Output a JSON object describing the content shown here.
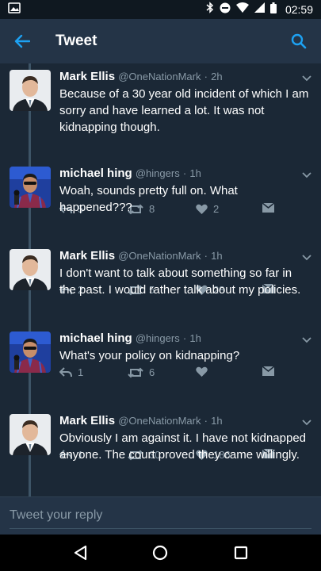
{
  "status_bar": {
    "time": "02:59"
  },
  "app_bar": {
    "title": "Tweet"
  },
  "tweets": [
    {
      "name": "Mark Ellis",
      "handle": "@OneNationMark",
      "time": "2h",
      "text": "Because of a 30 year old incident of which I am sorry and have learned a lot. It was not kidnapping though.",
      "replies": "5",
      "retweets": "8",
      "likes": "2",
      "avatar": "mark-ellis"
    },
    {
      "name": "michael hing",
      "handle": "@hingers",
      "time": "1h",
      "text": "Woah, sounds pretty full on. What happened???",
      "replies": "2",
      "retweets": "5",
      "likes": "28",
      "avatar": "michael-hing"
    },
    {
      "name": "Mark Ellis",
      "handle": "@OneNationMark",
      "time": "1h",
      "text": "I don't want to talk about something so far in the past. I would rather talk about my policies.",
      "replies": "1",
      "retweets": "6",
      "likes": "",
      "avatar": "mark-ellis"
    },
    {
      "name": "michael hing",
      "handle": "@hingers",
      "time": "1h",
      "text": "What's your policy on kidnapping?",
      "replies": "1",
      "retweets": "30",
      "likes": "186",
      "avatar": "michael-hing"
    },
    {
      "name": "Mark Ellis",
      "handle": "@OneNationMark",
      "time": "1h",
      "text": "Obviously I am against it. I have not kidnapped anyone. The court proved they came willingly.",
      "replies": "12",
      "retweets": "14",
      "likes": "6",
      "avatar": "mark-ellis"
    }
  ],
  "reply": {
    "placeholder": "Tweet your reply"
  },
  "colors": {
    "accent": "#1da1f2",
    "background": "#1b2836",
    "bar": "#243447",
    "muted": "#8899a6"
  }
}
